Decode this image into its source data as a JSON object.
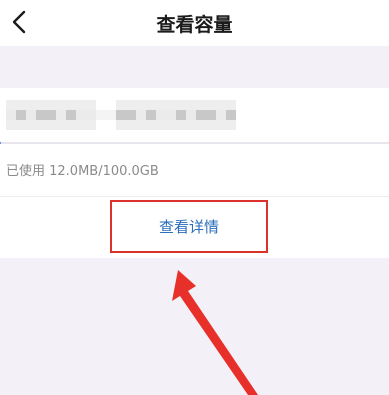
{
  "nav": {
    "title": "查看容量",
    "back_icon": "back-arrow-icon"
  },
  "storage": {
    "name_masked": true,
    "usage_text": "已使用 12.0MB/100.0GB",
    "used_fraction": 0.0001
  },
  "actions": {
    "view_details_label": "查看详情"
  },
  "colors": {
    "background": "#f3f0f8",
    "card": "#ffffff",
    "link": "#2a6dba",
    "highlight": "#d9332b"
  }
}
